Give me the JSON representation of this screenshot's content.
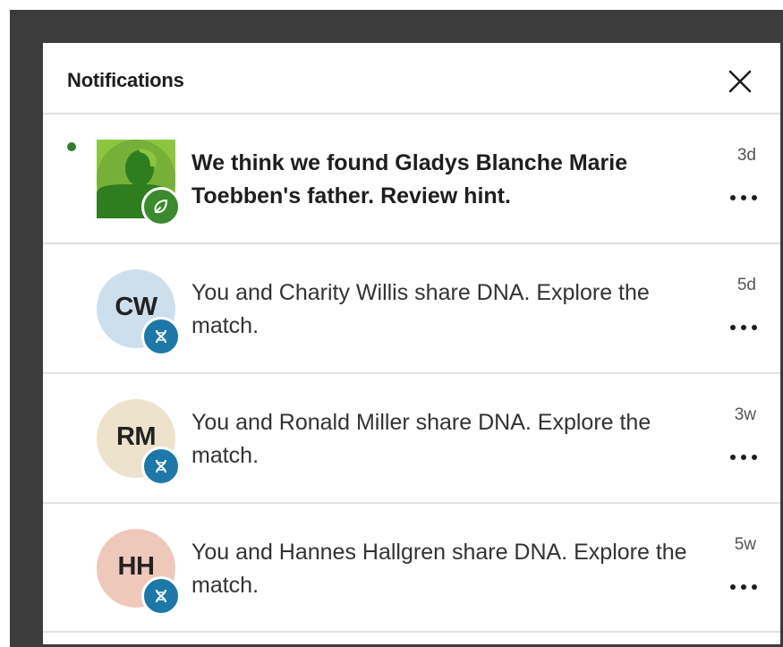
{
  "panel": {
    "title": "Notifications",
    "close_icon": "close-icon"
  },
  "colors": {
    "unread_dot": "#2f7d32",
    "hint_badge": "#3c8a2e",
    "dna_badge": "#1d78a8",
    "divider": "#e2e2e2",
    "frame": "#3c3c3c"
  },
  "notifications": [
    {
      "unread": true,
      "avatar_type": "photo",
      "badge_icon": "leaf-icon",
      "message": "We think we found Gladys Blanche Marie Toebben's father. Review hint.",
      "time": "3d",
      "more_icon": "more-options-icon"
    },
    {
      "unread": false,
      "avatar_type": "initials",
      "initials": "CW",
      "avatar_color": "#cddfec",
      "badge_icon": "dna-icon",
      "message": "You and Charity Willis share DNA. Explore the match.",
      "time": "5d",
      "more_icon": "more-options-icon"
    },
    {
      "unread": false,
      "avatar_type": "initials",
      "initials": "RM",
      "avatar_color": "#ede3cc",
      "badge_icon": "dna-icon",
      "message": "You and Ronald Miller share DNA. Explore the match.",
      "time": "3w",
      "more_icon": "more-options-icon"
    },
    {
      "unread": false,
      "avatar_type": "initials",
      "initials": "HH",
      "avatar_color": "#efc8bc",
      "badge_icon": "dna-icon",
      "message": "You and Hannes Hallgren share DNA. Explore the match.",
      "time": "5w",
      "more_icon": "more-options-icon"
    }
  ]
}
